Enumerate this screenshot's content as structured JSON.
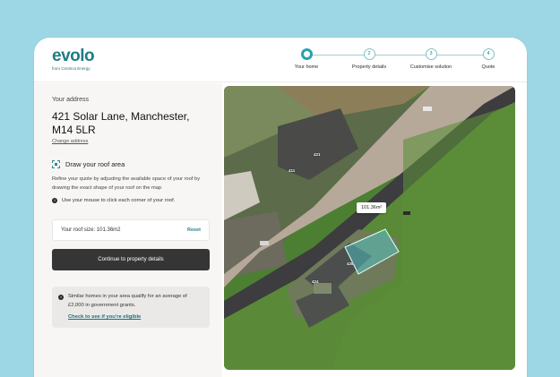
{
  "brand": {
    "logo": "evolo",
    "tagline": "from Centrica Energy"
  },
  "steps": [
    {
      "num": "",
      "label": "Your home",
      "active": true
    },
    {
      "num": "2",
      "label": "Property details",
      "active": false
    },
    {
      "num": "3",
      "label": "Customise solution",
      "active": false
    },
    {
      "num": "4",
      "label": "Quote",
      "active": false
    }
  ],
  "address": {
    "label": "Your address",
    "line1": "421 Solar Lane, Manchester,",
    "line2": "M14 5LR",
    "change_link": "Change address"
  },
  "draw": {
    "title": "Draw your roof area",
    "description": "Refine your quote by adjusting the available space of your roof by drawing the exact shape of your roof on the map",
    "hint": "Use your mouse to click each corner of your roof."
  },
  "roof": {
    "size_text": "Your roof size: 101.36m2",
    "reset_label": "Reset"
  },
  "continue_label": "Continue to property details",
  "grant": {
    "text": "Similar homes in your area qualify for an average of £2,000 in government grants.",
    "link": "Check to see if you're eligible"
  },
  "map": {
    "area_label": "101.36m²",
    "house_numbers": [
      "421",
      "411",
      "424",
      "428"
    ],
    "polygon_color": "#4fd0d8"
  },
  "colors": {
    "accent": "#27a3ad",
    "background": "#9dd6e4",
    "button": "#353536"
  }
}
